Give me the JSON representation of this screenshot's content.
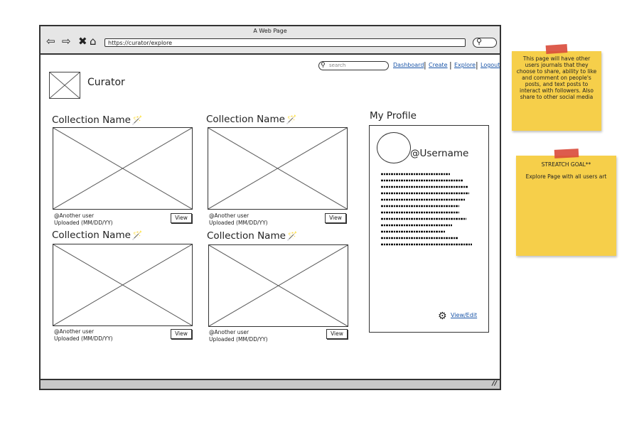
{
  "browser": {
    "title": "A Web Page",
    "url": "https://curator/explore",
    "nav_icons": [
      "back-arrow-icon",
      "forward-arrow-icon",
      "close-icon",
      "home-icon"
    ]
  },
  "topnav": {
    "search_placeholder": "search",
    "links": [
      "Dashboard",
      "Create",
      "Explore",
      "Logout"
    ]
  },
  "brand": {
    "name": "Curator"
  },
  "collections": [
    {
      "title": "Collection Name",
      "user": "@Another user",
      "uploaded": "Uploaded (MM/DD/YY)",
      "button": "View"
    },
    {
      "title": "Collection Name",
      "user": "@Another user",
      "uploaded": "Uploaded (MM/DD/YY)",
      "button": "View"
    },
    {
      "title": "Collection Name",
      "user": "@Another user",
      "uploaded": "Uploaded (MM/DD/YY)",
      "button": "View"
    },
    {
      "title": "Collection Name",
      "user": "@Another user",
      "uploaded": "Uploaded (MM/DD/YY)",
      "button": "View"
    }
  ],
  "profile": {
    "heading": "My Profile",
    "username": "@Username",
    "link": "View/Edit"
  },
  "notes": [
    {
      "text": "This page will have other users journals that they choose to share, ability to like and comment on people's posts, and text posts to interact with followers. Also share to other social media"
    },
    {
      "title": "STREATCH GOAL**",
      "text": "Explore Page with all users art"
    }
  ],
  "colors": {
    "sticky": "#f6cf4a",
    "tape": "#d94a3a",
    "link": "#1a55a8"
  }
}
